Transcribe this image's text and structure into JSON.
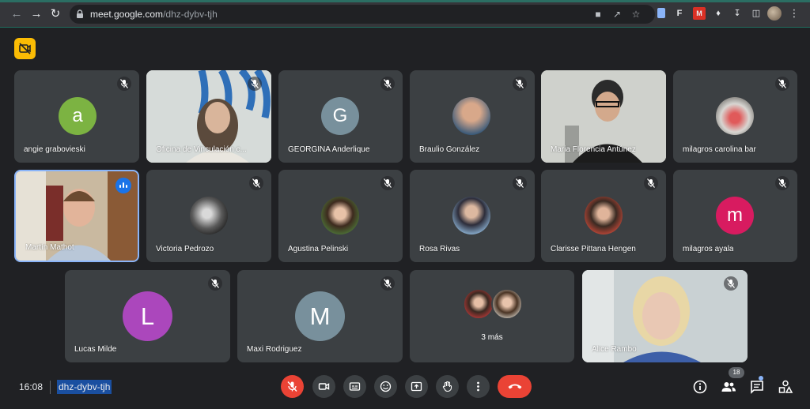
{
  "browser": {
    "url_host": "meet.google.com",
    "url_path": "/dhz-dybv-tjh",
    "icons": [
      "back-arrow-icon",
      "forward-arrow-icon",
      "reload-icon",
      "lock-icon",
      "camera-blocked-icon",
      "share-icon",
      "bookmark-star-icon",
      "docs-extension-icon",
      "f-extension-icon",
      "m-extension-icon",
      "puzzle-icon",
      "download-icon",
      "sidebar-icon",
      "profile-avatar",
      "kebab-menu-icon"
    ]
  },
  "colors": {
    "stage": "#202124",
    "tile": "#3c4043",
    "accent_blue": "#1a73e8",
    "danger": "#ea4335",
    "warning": "#fbbc04"
  },
  "participants": [
    {
      "name": "angie grabovieski",
      "avatar": "a",
      "color": "#7cb342",
      "muted": true
    },
    {
      "name": "Oficina de Vinculación c...",
      "avatar": "video",
      "muted": true
    },
    {
      "name": "GEORGINA Anderlique",
      "avatar": "G",
      "color": "#78909c",
      "muted": true
    },
    {
      "name": "Braulio González",
      "avatar": "photo",
      "muted": true
    },
    {
      "name": "Maria Florencia Antúnez",
      "avatar": "video",
      "muted": false
    },
    {
      "name": "milagros carolina bar",
      "avatar": "photo",
      "muted": true
    },
    {
      "name": "Martín Mathot",
      "avatar": "video",
      "muted": false,
      "speaking": true
    },
    {
      "name": "Victoria Pedrozo",
      "avatar": "photo",
      "muted": true
    },
    {
      "name": "Agustina Pelinski",
      "avatar": "photo",
      "muted": true
    },
    {
      "name": "Rosa Rivas",
      "avatar": "photo",
      "muted": true
    },
    {
      "name": "Clarisse Pittana Hengen",
      "avatar": "photo",
      "muted": true
    },
    {
      "name": "milagros ayala",
      "avatar": "m",
      "color": "#d81b60",
      "muted": true
    },
    {
      "name": "Lucas Milde",
      "avatar": "L",
      "color": "#ab47bc",
      "muted": true
    },
    {
      "name": "Maxi Rodriguez",
      "avatar": "M",
      "color": "#78909c",
      "muted": true
    },
    {
      "name": "3 más",
      "avatar": "group",
      "muted": false
    },
    {
      "name": "Alice Rambo",
      "avatar": "video",
      "muted": true
    }
  ],
  "bottom_bar": {
    "time": "16:08",
    "meeting_code": "dhz-dybv-tjh",
    "participant_count": "18",
    "controls": [
      "mic-off-button",
      "camera-button",
      "captions-button",
      "emoji-button",
      "present-button",
      "raise-hand-button",
      "more-options-button",
      "leave-call-button"
    ],
    "right_controls": [
      "info-button",
      "people-button",
      "chat-button",
      "activities-button"
    ]
  }
}
